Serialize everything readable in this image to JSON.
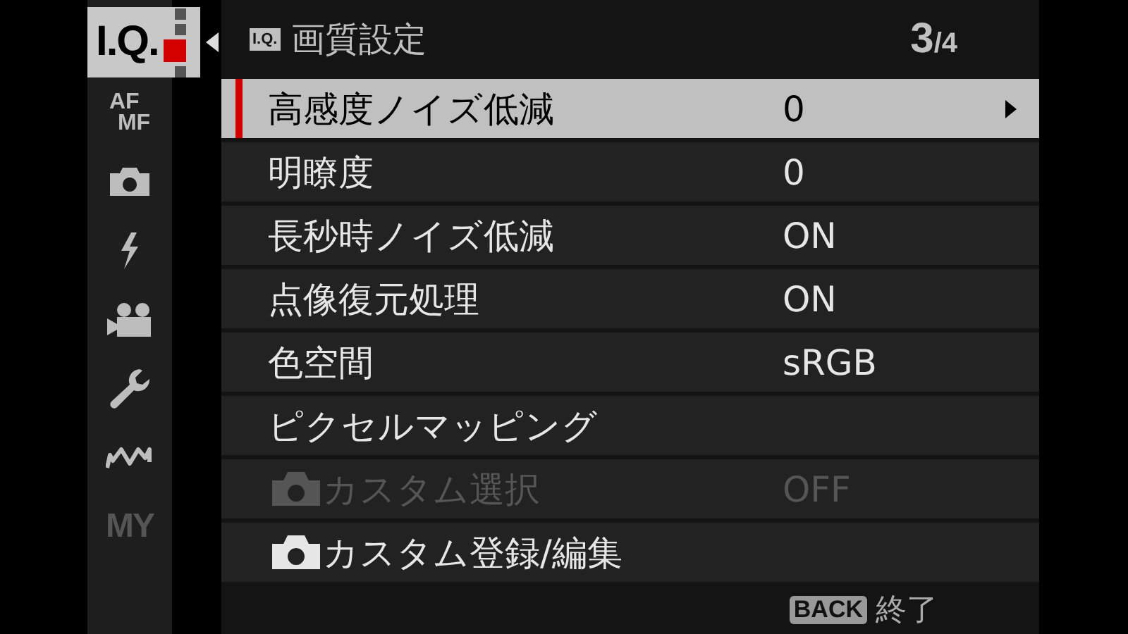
{
  "sidebar": {
    "tabs": [
      {
        "kind": "text",
        "label": "I.Q.",
        "selected": true,
        "disabled": false
      },
      {
        "kind": "stack",
        "label": "AF",
        "label2": "MF",
        "selected": false,
        "disabled": false
      },
      {
        "kind": "camera",
        "selected": false,
        "disabled": false
      },
      {
        "kind": "flash",
        "selected": false,
        "disabled": false
      },
      {
        "kind": "movie",
        "selected": false,
        "disabled": false
      },
      {
        "kind": "wrench",
        "selected": false,
        "disabled": false
      },
      {
        "kind": "wireless",
        "selected": false,
        "disabled": false
      },
      {
        "kind": "text",
        "label": "MY",
        "selected": false,
        "disabled": true
      }
    ],
    "pages": [
      {
        "selected": false
      },
      {
        "selected": false
      },
      {
        "selected": true
      },
      {
        "selected": false
      }
    ]
  },
  "header": {
    "badge": "I.Q.",
    "title": "画質設定",
    "page": "3",
    "total": "/4"
  },
  "rows": [
    {
      "kind": "plain",
      "label": "高感度ノイズ低減",
      "value": "0",
      "selected": true,
      "disabled": false
    },
    {
      "kind": "plain",
      "label": "明瞭度",
      "value": "0",
      "selected": false,
      "disabled": false
    },
    {
      "kind": "plain",
      "label": "長秒時ノイズ低減",
      "value": "ON",
      "selected": false,
      "disabled": false
    },
    {
      "kind": "plain",
      "label": "点像復元処理",
      "value": "ON",
      "selected": false,
      "disabled": false
    },
    {
      "kind": "plain",
      "label": "色空間",
      "value": "sRGB",
      "selected": false,
      "disabled": false
    },
    {
      "kind": "plain",
      "label": "ピクセルマッピング",
      "selected": false,
      "disabled": false
    },
    {
      "kind": "camera",
      "label": "カスタム選択",
      "value": "OFF",
      "selected": false,
      "disabled": true
    },
    {
      "kind": "camera",
      "label": "カスタム登録/編集",
      "selected": false,
      "disabled": false
    }
  ],
  "footer": {
    "key": "BACK",
    "action": "終了"
  }
}
